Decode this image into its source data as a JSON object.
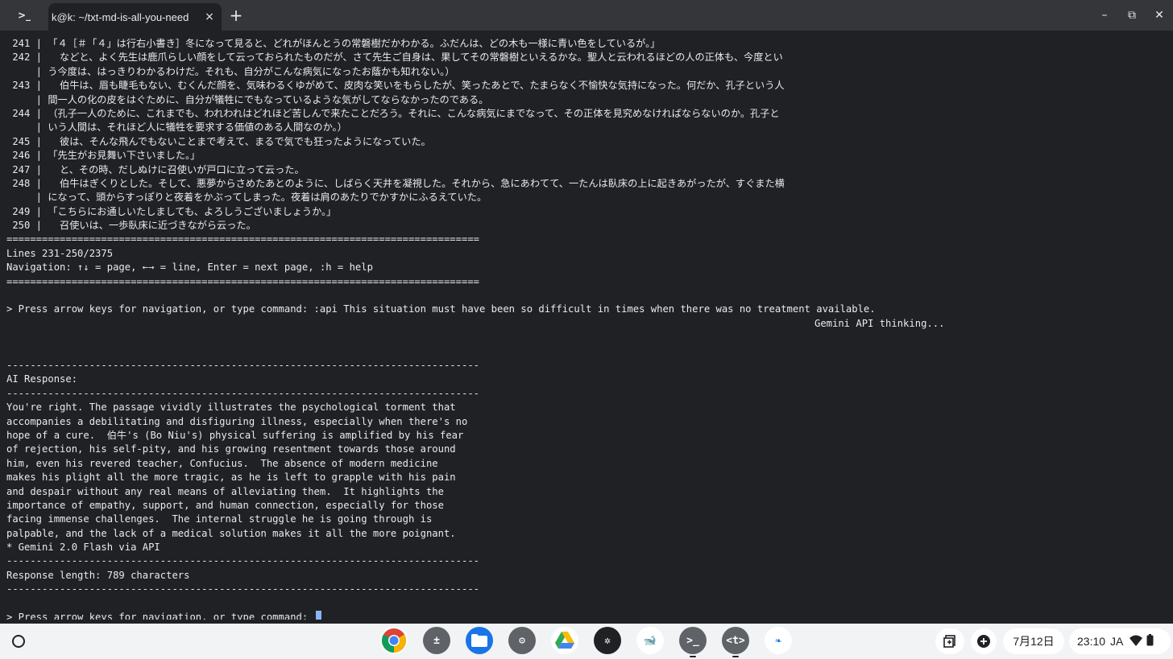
{
  "window": {
    "tab_icon_glyph": ">_",
    "tab_title": "k@k: ~/txt-md-is-all-you-need",
    "tab_close": "×",
    "new_tab": "+",
    "minimize": "–",
    "maximize": "⧉",
    "close": "✕"
  },
  "terminal": {
    "lines": [
      " 241 | 「４［＃「４」は行右小書き］冬になって見ると、どれがほんとうの常磐樹だかわかる。ふだんは、どの木も一様に青い色をしているが。」",
      " 242 |   などと、よく先生は鹿爪らしい顔をして云っておられたものだが、さて先生ご自身は、果してその常磐樹といえるかな。聖人と云われるほどの人の正体も、今度とい",
      "     | う今度は、はっきりわかるわけだ。それも、自分がこんな病気になったお蔭かも知れない。）",
      " 243 |   伯牛は、眉も睫毛もない、むくんだ顔を、気味わるくゆがめて、皮肉な笑いをもらしたが、笑ったあとで、たまらなく不愉快な気持になった。何だか、孔子という人",
      "     | 間一人の化の皮をはぐために、自分が犠牲にでもなっているような気がしてならなかったのである。",
      " 244 | （孔子一人のために、これまでも、われわれはどれほど苦しんで来たことだろう。それに、こんな病気にまでなって、その正体を見究めなければならないのか。孔子と",
      "     | いう人間は、それほど人に犠牲を要求する価値のある人間なのか。）",
      " 245 |   彼は、そんな飛んでもないことまで考えて、まるで気でも狂ったようになっていた。",
      " 246 | 「先生がお見舞い下さいました。」",
      " 247 |   と、その時、だしぬけに召使いが戸口に立って云った。",
      " 248 |   伯牛はぎくりとした。そして、悪夢からさめたあとのように、しばらく天井を凝視した。それから、急にあわてて、一たんは臥床の上に起きあがったが、すぐまた横",
      "     | になって、頭からすっぽりと夜着をかぶってしまった。夜着は肩のあたりでかすかにふるえていた。",
      " 249 | 「こちらにお通しいたしましても、よろしうございましょうか。」",
      " 250 |   召使いは、一歩臥床に近づきながら云った。",
      "================================================================================",
      "Lines 231-250/2375",
      "Navigation: ↑↓ = page, ←→ = line, Enter = next page, :h = help",
      "================================================================================",
      "",
      "> Press arrow keys for navigation, or type command: :api This situation must have been so difficult in times when there was no treatment available.",
      "Gemini API thinking...",
      "",
      "",
      "--------------------------------------------------------------------------------",
      "AI Response:",
      "--------------------------------------------------------------------------------",
      "You're right. The passage vividly illustrates the psychological torment that",
      "accompanies a debilitating and disfiguring illness, especially when there's no",
      "hope of a cure.  伯牛's (Bo Niu's) physical suffering is amplified by his fear",
      "of rejection, his self-pity, and his growing resentment towards those around",
      "him, even his revered teacher, Confucius.  The absence of modern medicine",
      "makes his plight all the more tragic, as he is left to grapple with his pain",
      "and despair without any real means of alleviating them.  It highlights the",
      "importance of empathy, support, and human connection, especially for those",
      "facing immense challenges.  The internal struggle he is going through is",
      "palpable, and the lack of a medical solution makes it all the more poignant.",
      "* Gemini 2.0 Flash via API",
      "--------------------------------------------------------------------------------",
      "Response length: 789 characters",
      "--------------------------------------------------------------------------------",
      "",
      "> Press arrow keys for navigation, or type command: "
    ],
    "right_aligned_index": 20,
    "prompt_index": 41
  },
  "shelf": {
    "apps": [
      {
        "name": "chrome-app-icon",
        "glyph": "",
        "color": "#ffffff"
      },
      {
        "name": "calculator-app-icon",
        "glyph": "±",
        "color": "#5f6368"
      },
      {
        "name": "files-app-icon",
        "glyph": "",
        "color": "#1a73e8"
      },
      {
        "name": "settings-app-icon",
        "glyph": "⚙",
        "color": "#5f6368"
      },
      {
        "name": "drive-app-icon",
        "glyph": "▲",
        "color": "#ffffff"
      },
      {
        "name": "perplexity-app-icon",
        "glyph": "✲",
        "color": "#202124"
      },
      {
        "name": "deepseek-app-icon",
        "glyph": "🐋",
        "color": "#ffffff"
      },
      {
        "name": "terminal-app-icon",
        "glyph": ">_",
        "color": "#5f6368"
      },
      {
        "name": "text-app-icon",
        "glyph": "<t>",
        "color": "#5f6368"
      },
      {
        "name": "feather-app-icon",
        "glyph": "❧",
        "color": "#ffffff"
      }
    ],
    "date": "7月12日",
    "time": "23:10",
    "ime": "JA"
  }
}
